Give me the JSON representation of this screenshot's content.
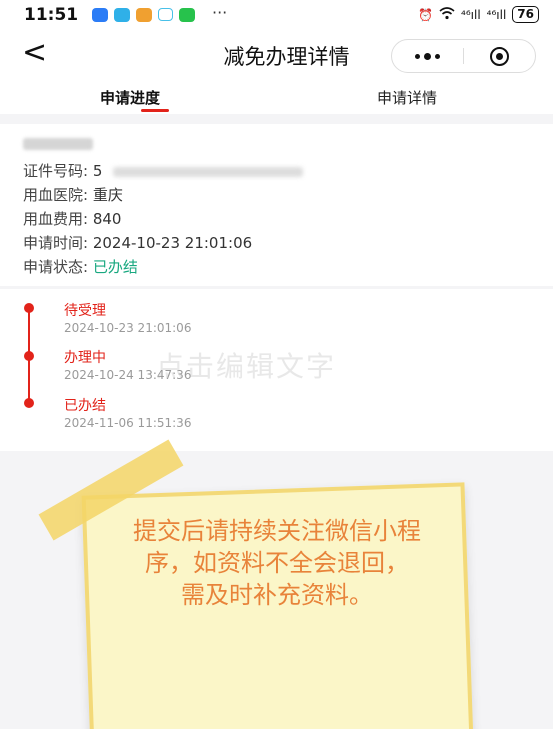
{
  "status_bar": {
    "time": "11:51",
    "dots": "···",
    "signal_1": "⁴⁶ıll",
    "signal_2": "⁴⁶ıll",
    "battery": "76"
  },
  "nav": {
    "back": "<",
    "title": "减免办理详情"
  },
  "tabs": [
    {
      "label": "申请进度",
      "active": true
    },
    {
      "label": "申请详情",
      "active": false
    }
  ],
  "info": {
    "id_label": "证件号码:",
    "id_value": "5",
    "hospital_label": "用血医院:",
    "hospital_value": "重庆",
    "cost_label": "用血费用:",
    "cost_value": "840",
    "time_label": "申请时间:",
    "time_value": "2024-10-23 21:01:06",
    "status_label": "申请状态:",
    "status_value": "已办结"
  },
  "timeline": [
    {
      "title": "待受理",
      "time": "2024-10-23 21:01:06"
    },
    {
      "title": "办理中",
      "time": "2024-10-24 13:47:36"
    },
    {
      "title": "已办结",
      "time": "2024-11-06 11:51:36"
    }
  ],
  "watermark": "点击编辑文字",
  "note": {
    "text": "提交后请持续关注微信小程序，如资料不全会退回， 需及时补充资料。"
  },
  "colors": {
    "accent_red": "#e2231a",
    "status_green": "#19a880",
    "note_text": "#e8833a"
  }
}
